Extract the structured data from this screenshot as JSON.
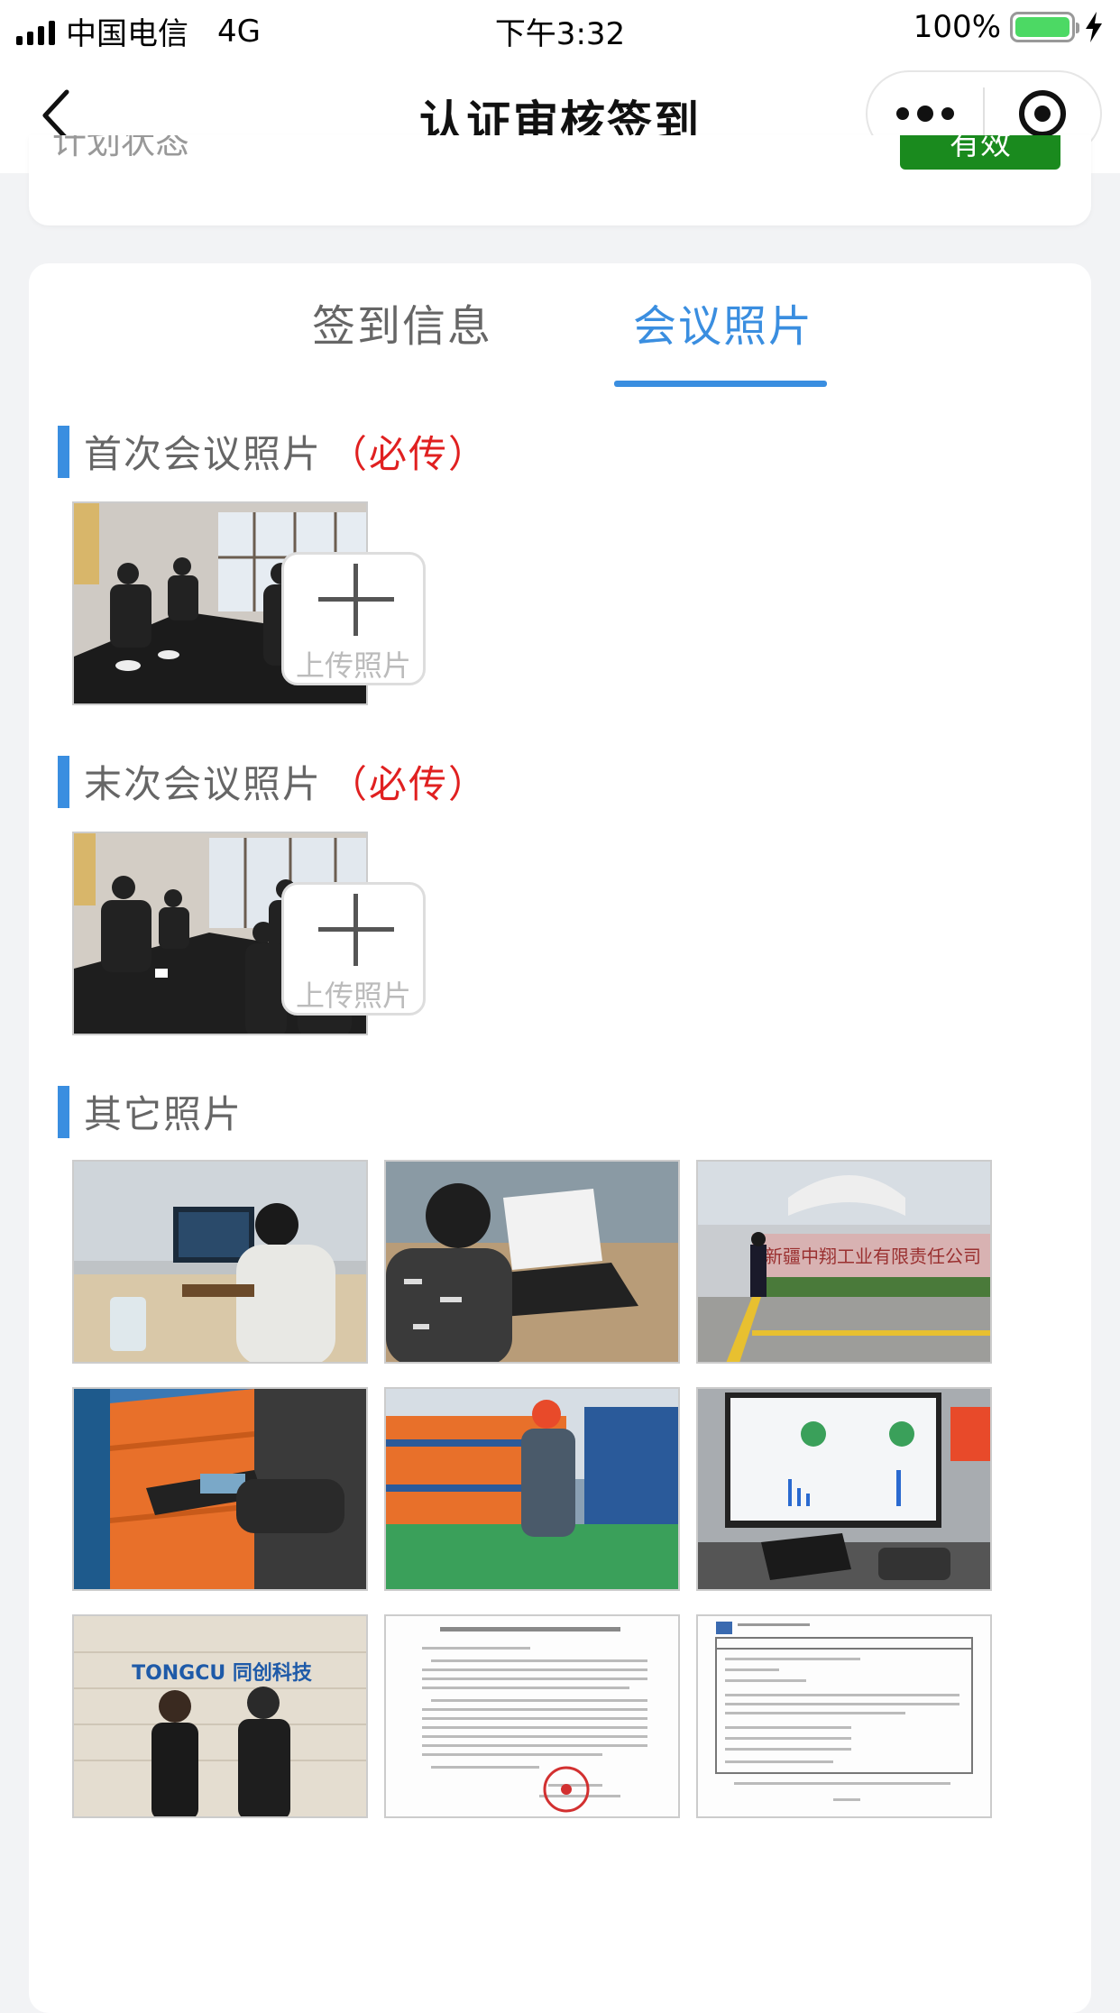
{
  "status_bar": {
    "carrier": "中国电信",
    "network": "4G",
    "time": "下午3:32",
    "battery": "100%"
  },
  "nav": {
    "title": "认证审核签到"
  },
  "top_card": {
    "label": "计划状态",
    "status": "有效"
  },
  "tabs": [
    {
      "label": "签到信息",
      "active": false
    },
    {
      "label": "会议照片",
      "active": true
    }
  ],
  "sections": {
    "first": {
      "title": "首次会议照片",
      "required": "（必传）"
    },
    "last": {
      "title": "末次会议照片",
      "required": "（必传）"
    },
    "other": {
      "title": "其它照片"
    }
  },
  "upload_label": "上传照片",
  "other_photos_header_text": {
    "company_sign": "新疆中翔工业有限责任公司",
    "logo_text": "TONGCU 同创科技"
  },
  "colors": {
    "accent": "#3a8ee0",
    "required": "#e02020",
    "valid_badge": "#1a8a1e"
  }
}
